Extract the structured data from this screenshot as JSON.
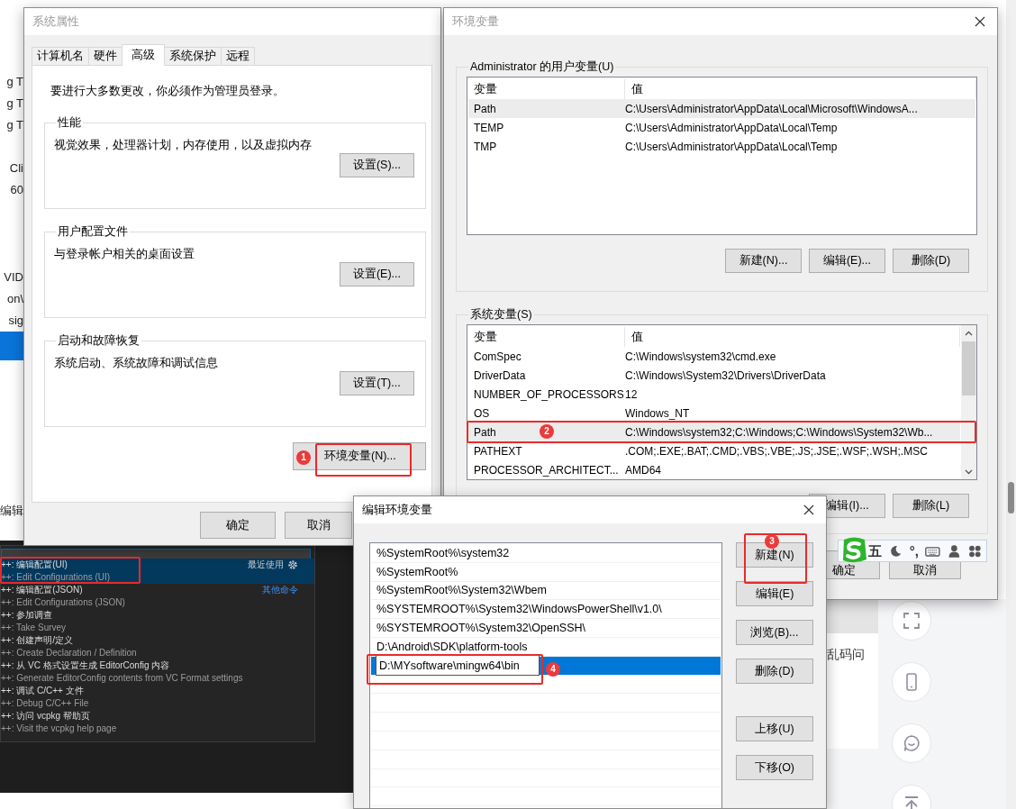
{
  "background": {
    "edge_texts": [
      "g T",
      "g T",
      "g T",
      "Cli",
      "60",
      "VID",
      "on\\",
      "sig",
      "编辑"
    ],
    "command_palette": [
      {
        "title": "++: 编辑配置(UI)",
        "subtitle": "++: Edit Configurations (UI)",
        "hint": "最近使用",
        "selected": true
      },
      {
        "title": "++: 编辑配置(JSON)",
        "subtitle": "++: Edit Configurations (JSON)",
        "hint": "其他命令",
        "selected": false
      },
      {
        "title": "++: 参加调查",
        "subtitle": "++: Take Survey",
        "selected": false
      },
      {
        "title": "++: 创建声明/定义",
        "subtitle": "++: Create Declaration / Definition",
        "selected": false
      },
      {
        "title": "++: 从 VC 格式设置生成 EditorConfig 内容",
        "subtitle": "++: Generate EditorConfig contents from VC Format settings",
        "selected": false
      },
      {
        "title": "++: 调试 C/C++ 文件",
        "subtitle": "++: Debug C/C++ File",
        "selected": false
      },
      {
        "title": "++: 访问 vcpkg 帮助页",
        "subtitle": "++: Visit the vcpkg help page",
        "selected": false
      }
    ],
    "article_text": "乱码问"
  },
  "system_properties": {
    "title": "系统属性",
    "tabs": [
      {
        "label": "计算机名",
        "selected": false
      },
      {
        "label": "硬件",
        "selected": false
      },
      {
        "label": "高级",
        "selected": true
      },
      {
        "label": "系统保护",
        "selected": false
      },
      {
        "label": "远程",
        "selected": false
      }
    ],
    "notice": "要进行大多数更改，你必须作为管理员登录。",
    "groups": [
      {
        "title": "性能",
        "description": "视觉效果，处理器计划，内存使用，以及虚拟内存",
        "button": "设置(S)..."
      },
      {
        "title": "用户配置文件",
        "description": "与登录帐户相关的桌面设置",
        "button": "设置(E)..."
      },
      {
        "title": "启动和故障恢复",
        "description": "系统启动、系统故障和调试信息",
        "button": "设置(T)..."
      }
    ],
    "env_button": "环境变量(N)...",
    "buttons": [
      "确定",
      "取消"
    ]
  },
  "environment_variables": {
    "title": "环境变量",
    "user_group": {
      "title": "Administrator 的用户变量(U)",
      "columns": [
        "变量",
        "值"
      ],
      "rows": [
        {
          "name": "Path",
          "value": "C:\\Users\\Administrator\\AppData\\Local\\Microsoft\\WindowsA...",
          "selected": true
        },
        {
          "name": "TEMP",
          "value": "C:\\Users\\Administrator\\AppData\\Local\\Temp",
          "selected": false
        },
        {
          "name": "TMP",
          "value": "C:\\Users\\Administrator\\AppData\\Local\\Temp",
          "selected": false
        }
      ],
      "buttons": [
        "新建(N)...",
        "编辑(E)...",
        "删除(D)"
      ]
    },
    "system_group": {
      "title": "系统变量(S)",
      "columns": [
        "变量",
        "值"
      ],
      "rows": [
        {
          "name": "ComSpec",
          "value": "C:\\Windows\\system32\\cmd.exe",
          "selected": false
        },
        {
          "name": "DriverData",
          "value": "C:\\Windows\\System32\\Drivers\\DriverData",
          "selected": false
        },
        {
          "name": "NUMBER_OF_PROCESSORS",
          "value": "12",
          "selected": false
        },
        {
          "name": "OS",
          "value": "Windows_NT",
          "selected": false
        },
        {
          "name": "Path",
          "value": "C:\\Windows\\system32;C:\\Windows;C:\\Windows\\System32\\Wb...",
          "selected": true
        },
        {
          "name": "PATHEXT",
          "value": ".COM;.EXE;.BAT;.CMD;.VBS;.VBE;.JS;.JSE;.WSF;.WSH;.MSC",
          "selected": false
        },
        {
          "name": "PROCESSOR_ARCHITECT...",
          "value": "AMD64",
          "selected": false
        }
      ],
      "buttons": [
        "编辑(I)...",
        "删除(L)"
      ]
    },
    "buttons": [
      "确定",
      "取消"
    ]
  },
  "edit_variable": {
    "title": "编辑环境变量",
    "entries": [
      {
        "text": "%SystemRoot%\\system32",
        "selected": false,
        "editing": false
      },
      {
        "text": "%SystemRoot%",
        "selected": false,
        "editing": false
      },
      {
        "text": "%SystemRoot%\\System32\\Wbem",
        "selected": false,
        "editing": false
      },
      {
        "text": "%SYSTEMROOT%\\System32\\WindowsPowerShell\\v1.0\\",
        "selected": false,
        "editing": false
      },
      {
        "text": "%SYSTEMROOT%\\System32\\OpenSSH\\",
        "selected": false,
        "editing": false
      },
      {
        "text": "D:\\Android\\SDK\\platform-tools",
        "selected": false,
        "editing": false
      },
      {
        "text": "D:\\MYsoftware\\mingw64\\bin",
        "selected": true,
        "editing": true
      }
    ],
    "buttons": [
      "新建(N)",
      "编辑(E)",
      "浏览(B)...",
      "删除(D)",
      "上移(U)",
      "下移(O)"
    ]
  },
  "ime_toolbar": {
    "items": [
      {
        "kind": "logo"
      },
      {
        "kind": "text",
        "label": "五"
      },
      {
        "kind": "moon"
      },
      {
        "kind": "text",
        "label": "°,"
      },
      {
        "kind": "keyboard"
      },
      {
        "kind": "person"
      },
      {
        "kind": "apps"
      }
    ]
  },
  "annotations": [
    {
      "kind": "numbered",
      "label": "1"
    },
    {
      "kind": "numbered",
      "label": "2"
    },
    {
      "kind": "numbered",
      "label": "3"
    },
    {
      "kind": "numbered",
      "label": "4"
    },
    {
      "kind": "frame"
    }
  ]
}
